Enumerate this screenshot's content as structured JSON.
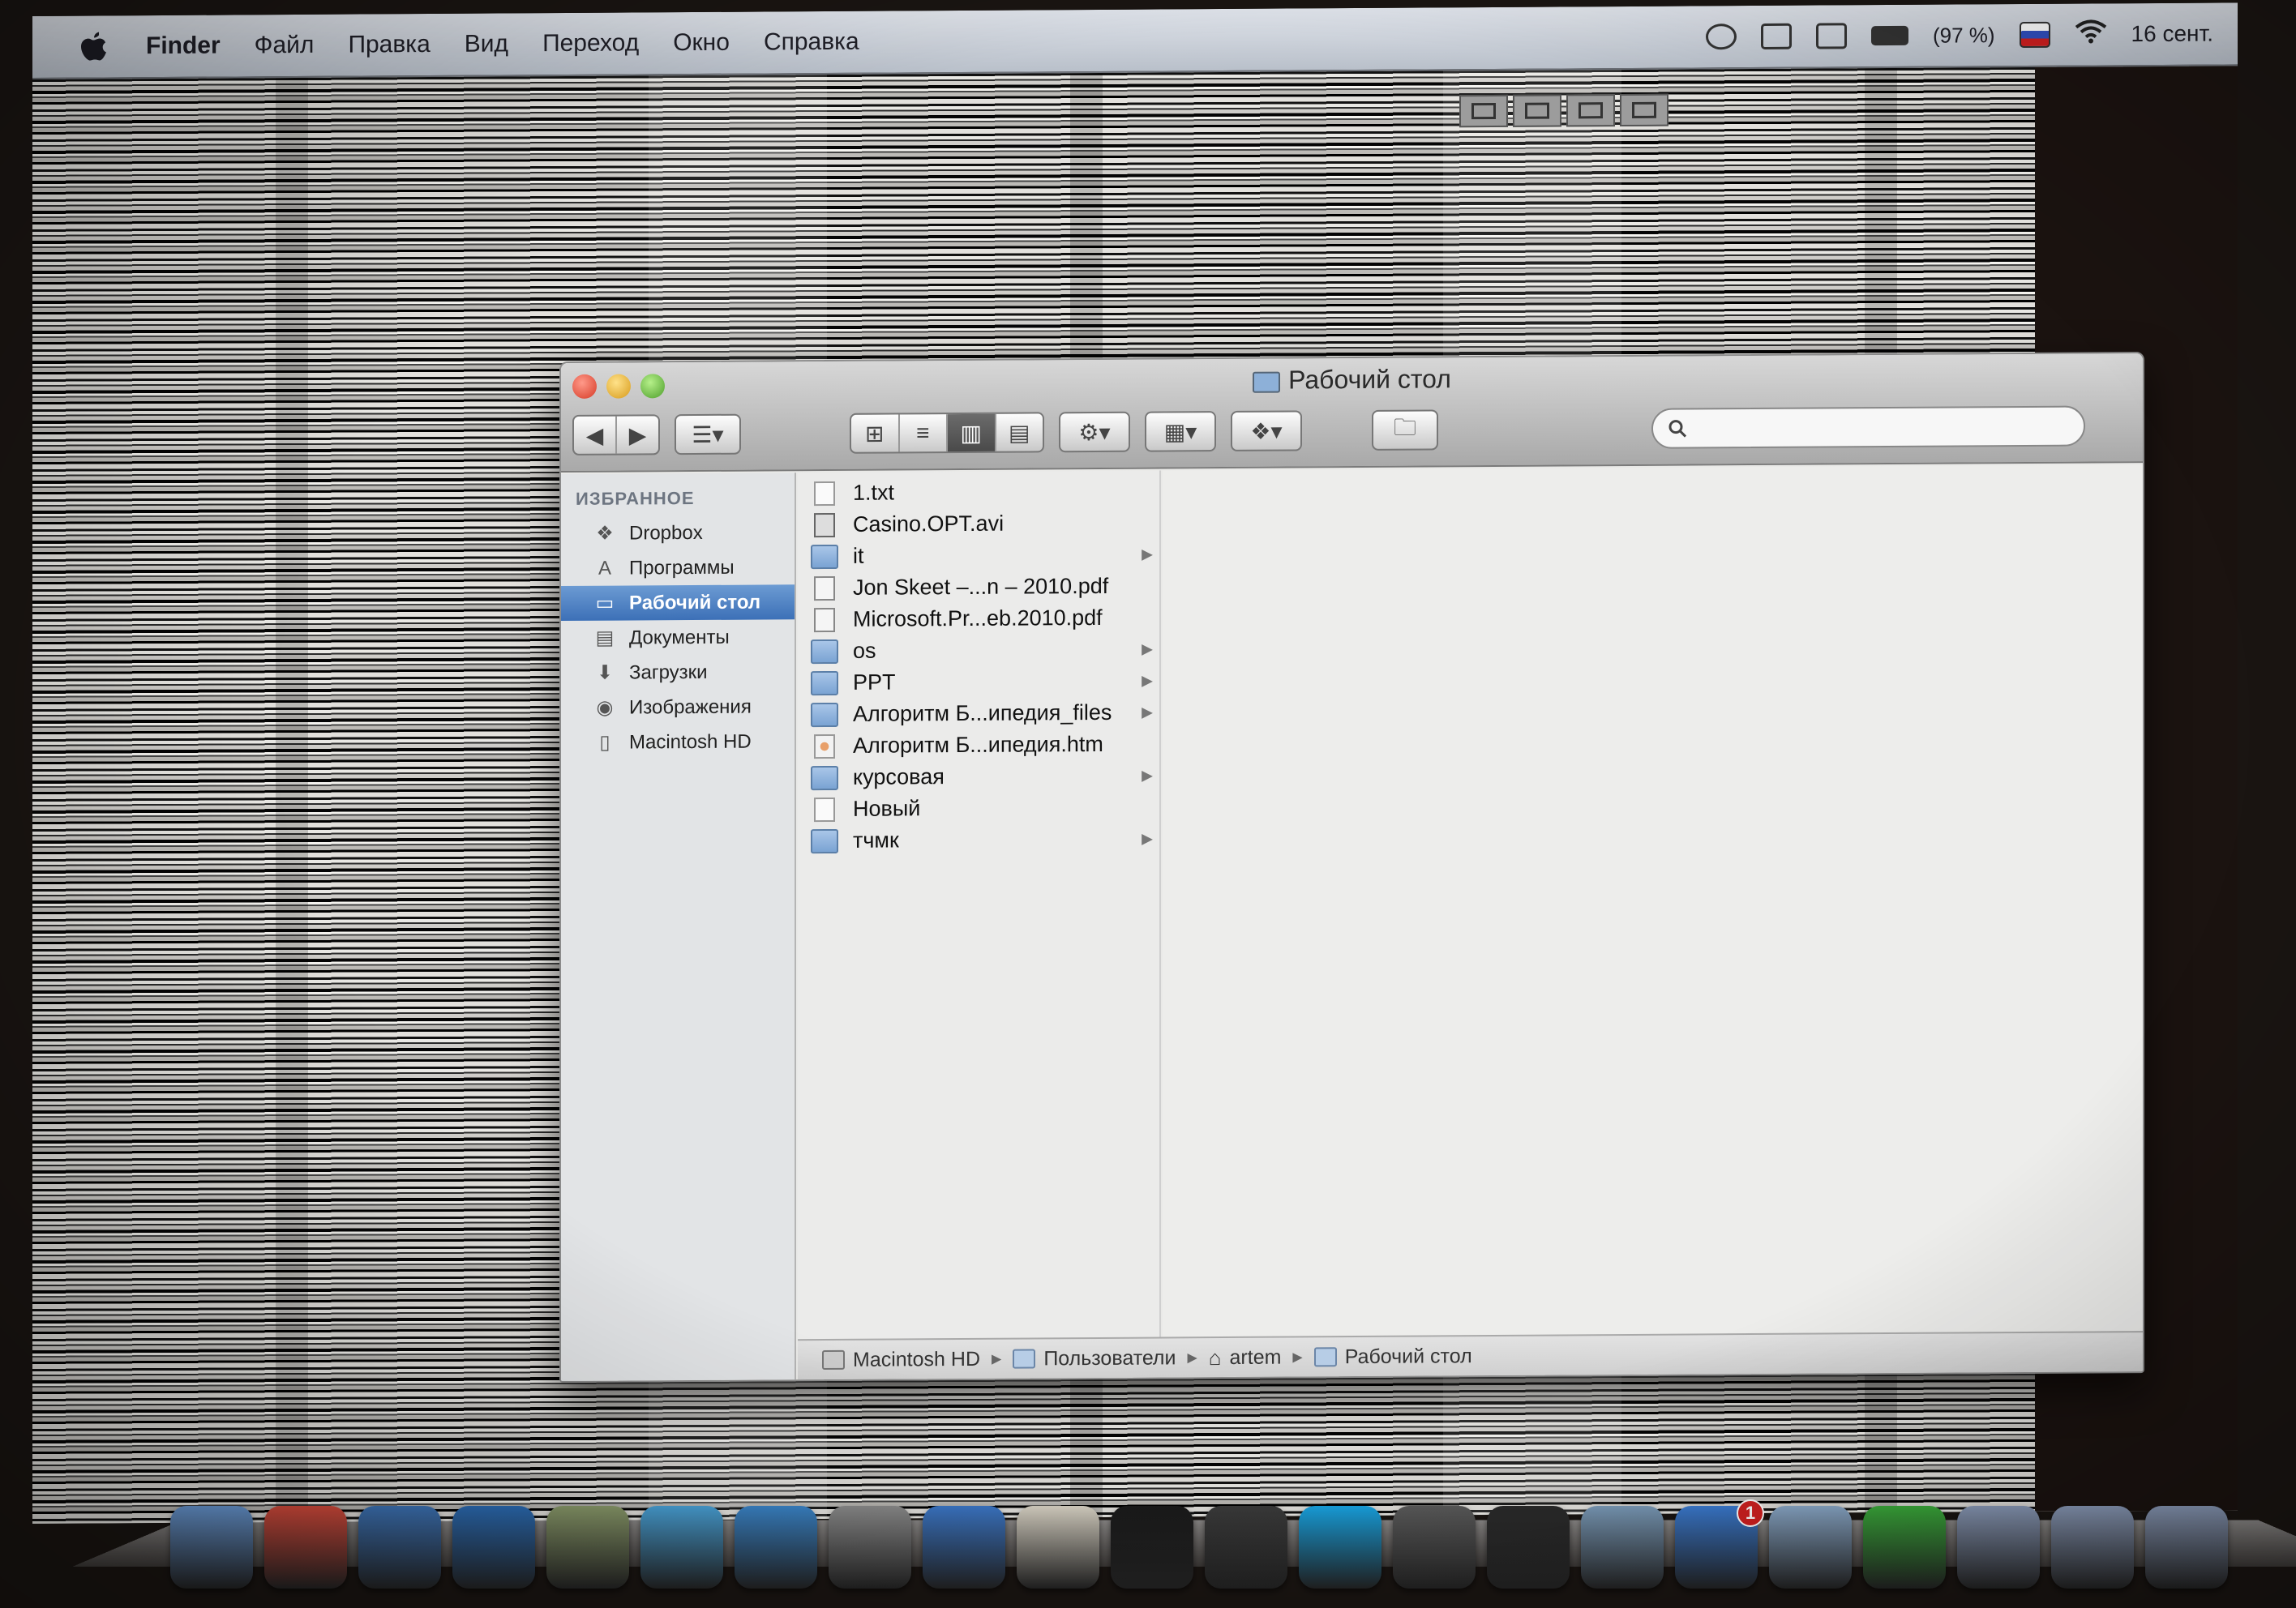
{
  "menubar": {
    "app_name": "Finder",
    "menus": [
      "Файл",
      "Правка",
      "Вид",
      "Переход",
      "Окно",
      "Справка"
    ],
    "battery": "(97 %)",
    "clock": "16 сент."
  },
  "window": {
    "title": "Рабочий стол",
    "search": {
      "placeholder": ""
    }
  },
  "sidebar": {
    "section": "ИЗБРАННОЕ",
    "items": [
      {
        "label": "Dropbox",
        "icon": "dropbox-icon"
      },
      {
        "label": "Программы",
        "icon": "applications-icon"
      },
      {
        "label": "Рабочий стол",
        "icon": "desktop-icon",
        "selected": true
      },
      {
        "label": "Документы",
        "icon": "documents-icon"
      },
      {
        "label": "Загрузки",
        "icon": "downloads-icon"
      },
      {
        "label": "Изображения",
        "icon": "pictures-icon"
      },
      {
        "label": "Macintosh HD",
        "icon": "hard-drive-icon"
      }
    ]
  },
  "files": [
    {
      "name": "1.txt",
      "type": "doc",
      "folder": false
    },
    {
      "name": "Casino.OPT.avi",
      "type": "movie",
      "folder": false
    },
    {
      "name": "it",
      "type": "folder",
      "folder": true
    },
    {
      "name": "Jon Skeet –...n – 2010.pdf",
      "type": "pdf",
      "folder": false
    },
    {
      "name": "Microsoft.Pr...eb.2010.pdf",
      "type": "pdf",
      "folder": false
    },
    {
      "name": "os",
      "type": "folder",
      "folder": true
    },
    {
      "name": "PPT",
      "type": "folder",
      "folder": true
    },
    {
      "name": "Алгоритм Б...ипедия_files",
      "type": "folder",
      "folder": true
    },
    {
      "name": "Алгоритм Б...ипедия.htm",
      "type": "html",
      "folder": false
    },
    {
      "name": "курсовая",
      "type": "folder",
      "folder": true
    },
    {
      "name": "Новый",
      "type": "doc",
      "folder": false
    },
    {
      "name": "тчмк",
      "type": "folder",
      "folder": true
    }
  ],
  "pathbar": [
    "Macintosh HD",
    "Пользователи",
    "artem",
    "Рабочий стол"
  ],
  "dock": [
    {
      "name": "finder",
      "color": "#6a9bd8"
    },
    {
      "name": "chrome",
      "color": "#d84b3c"
    },
    {
      "name": "quicktime",
      "color": "#3d74b8"
    },
    {
      "name": "teamviewer",
      "color": "#2b6cb5"
    },
    {
      "name": "iphoto",
      "color": "#8a9a6a"
    },
    {
      "name": "twitter",
      "color": "#49a2d8"
    },
    {
      "name": "safari",
      "color": "#3a84c8"
    },
    {
      "name": "system-preferences",
      "color": "#8a8a8a"
    },
    {
      "name": "itunes",
      "color": "#3b76c6"
    },
    {
      "name": "textedit",
      "color": "#d8d2c4"
    },
    {
      "name": "terminal",
      "color": "#1a1a1a"
    },
    {
      "name": "adium",
      "color": "#3a3a3a"
    },
    {
      "name": "skype",
      "color": "#18a2e0"
    },
    {
      "name": "facetime",
      "color": "#5a5a5a"
    },
    {
      "name": "activity-monitor",
      "color": "#2a2a2a"
    },
    {
      "name": "network-utility",
      "color": "#7a9ab8"
    },
    {
      "name": "app-store",
      "color": "#3a7ad0",
      "badge": "1"
    },
    {
      "name": "mail",
      "color": "#8aa8c8"
    },
    {
      "name": "xcode",
      "color": "#3aaa3a"
    },
    {
      "name": "applications-stack",
      "color": "#8a9ab8"
    },
    {
      "name": "downloads-stack",
      "color": "#8a9ab8"
    },
    {
      "name": "documents-stack",
      "color": "#8a9ab8"
    }
  ]
}
